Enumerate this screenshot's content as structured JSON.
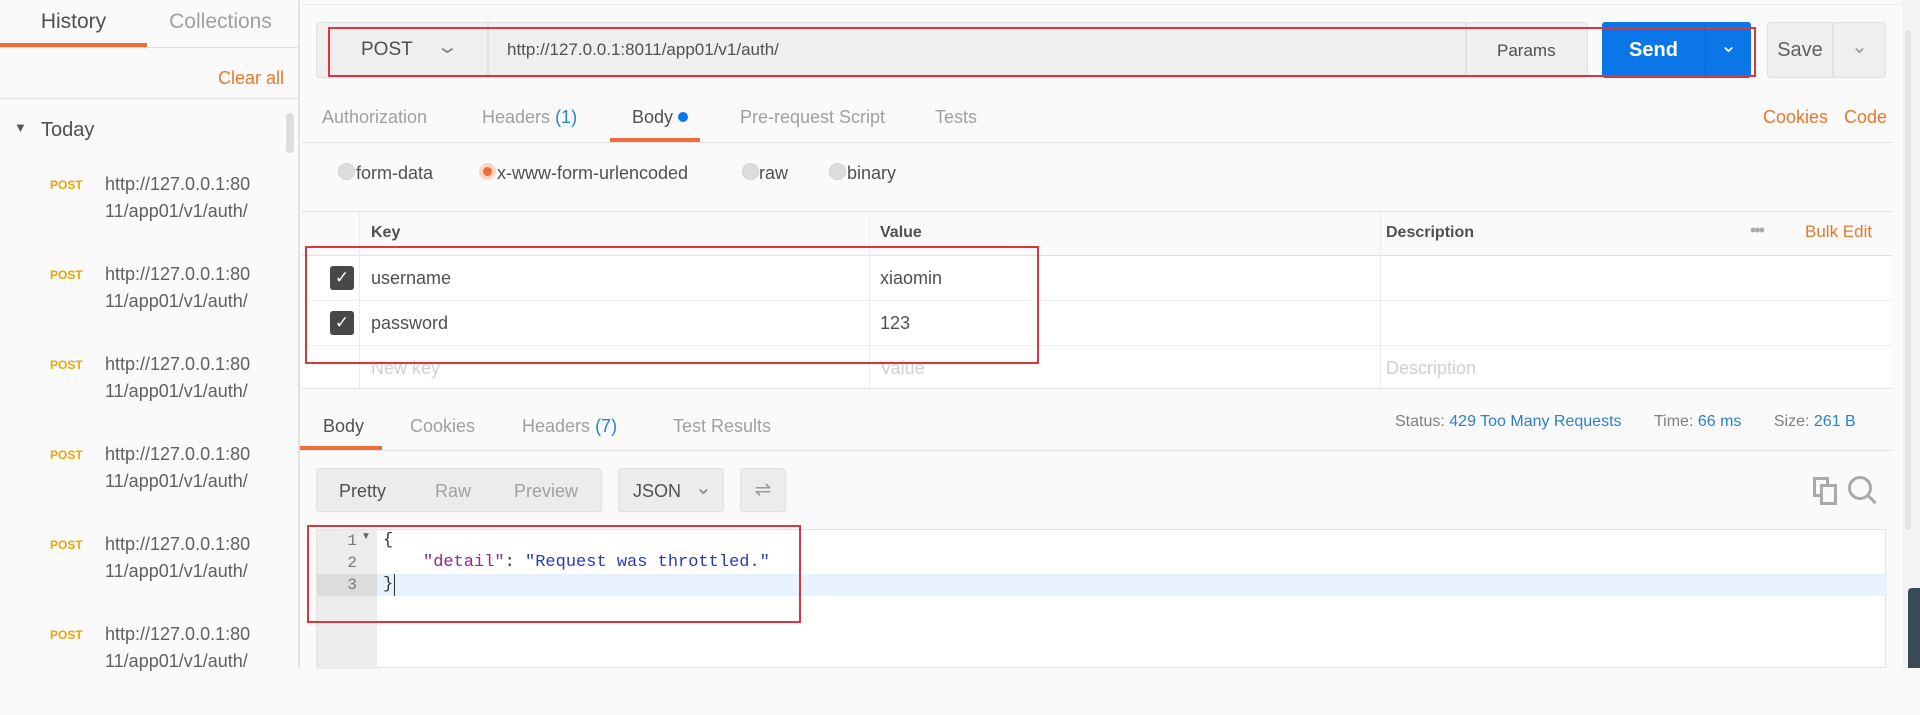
{
  "sidebar": {
    "tabs": [
      {
        "label": "History",
        "active": true
      },
      {
        "label": "Collections",
        "active": false
      }
    ],
    "clear_all": "Clear all",
    "group": "Today",
    "items": [
      {
        "method": "POST",
        "url": "http://127.0.0.1:8011/app01/v1/auth/"
      },
      {
        "method": "POST",
        "url": "http://127.0.0.1:8011/app01/v1/auth/"
      },
      {
        "method": "POST",
        "url": "http://127.0.0.1:8011/app01/v1/auth/"
      },
      {
        "method": "POST",
        "url": "http://127.0.0.1:8011/app01/v1/auth/"
      },
      {
        "method": "POST",
        "url": "http://127.0.0.1:8011/app01/v1/auth/"
      },
      {
        "method": "POST",
        "url": "http://127.0.0.1:8011/app01/v1/auth/"
      }
    ]
  },
  "request": {
    "method": "POST",
    "url": "http://127.0.0.1:8011/app01/v1/auth/",
    "params_label": "Params",
    "send_label": "Send",
    "save_label": "Save",
    "tabs": {
      "authorization": "Authorization",
      "headers": "Headers",
      "headers_count": "(1)",
      "body": "Body",
      "prerequest": "Pre-request Script",
      "tests": "Tests"
    },
    "cookies_link": "Cookies",
    "code_link": "Code",
    "body_types": [
      "form-data",
      "x-www-form-urlencoded",
      "raw",
      "binary"
    ],
    "body_type_selected": "x-www-form-urlencoded",
    "table": {
      "headers": {
        "key": "Key",
        "value": "Value",
        "description": "Description"
      },
      "bulk_edit": "Bulk Edit",
      "rows": [
        {
          "checked": true,
          "key": "username",
          "value": "xiaomin",
          "description": ""
        },
        {
          "checked": true,
          "key": "password",
          "value": "123",
          "description": ""
        }
      ],
      "placeholders": {
        "key": "New key",
        "value": "Value",
        "description": "Description"
      }
    }
  },
  "response": {
    "tabs": {
      "body": "Body",
      "cookies": "Cookies",
      "headers": "Headers",
      "headers_count": "(7)",
      "test_results": "Test Results"
    },
    "status_label": "Status:",
    "status": "429 Too Many Requests",
    "time_label": "Time:",
    "time": "66 ms",
    "size_label": "Size:",
    "size": "261 B",
    "view_modes": [
      "Pretty",
      "Raw",
      "Preview"
    ],
    "view_selected": "Pretty",
    "format": "JSON",
    "code_lines": [
      {
        "num": "1",
        "text": "{"
      },
      {
        "num": "2",
        "key": "\"detail\"",
        "sep": ": ",
        "value": "\"Request was throttled.\""
      },
      {
        "num": "3",
        "text": "}"
      }
    ]
  },
  "colors": {
    "accent": "#f26b3a",
    "send": "#0b76e8",
    "link": "#2a7fd4",
    "annotation": "#d9363e"
  }
}
